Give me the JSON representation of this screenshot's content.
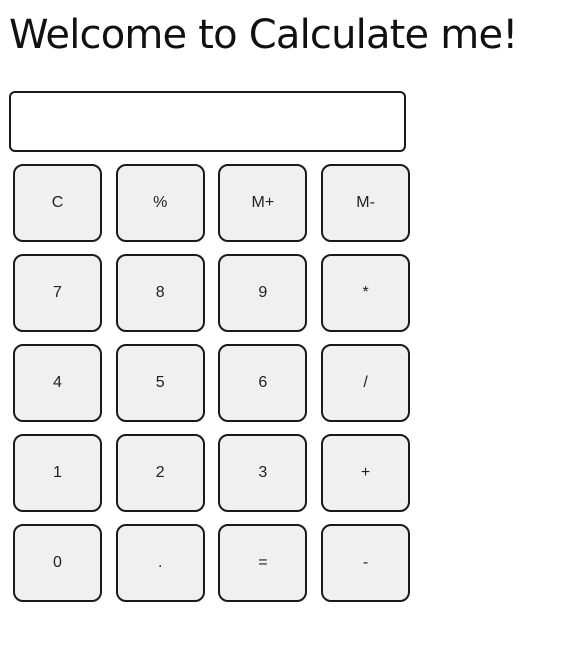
{
  "header": {
    "title": "Welcome to Calculate me!"
  },
  "display": {
    "value": ""
  },
  "keypad": {
    "rows": [
      [
        {
          "label": "C",
          "name": "clear-button"
        },
        {
          "label": "%",
          "name": "percent-button"
        },
        {
          "label": "M+",
          "name": "memory-add-button"
        },
        {
          "label": "M-",
          "name": "memory-subtract-button"
        }
      ],
      [
        {
          "label": "7",
          "name": "digit-7-button"
        },
        {
          "label": "8",
          "name": "digit-8-button"
        },
        {
          "label": "9",
          "name": "digit-9-button"
        },
        {
          "label": "*",
          "name": "multiply-button"
        }
      ],
      [
        {
          "label": "4",
          "name": "digit-4-button"
        },
        {
          "label": "5",
          "name": "digit-5-button"
        },
        {
          "label": "6",
          "name": "digit-6-button"
        },
        {
          "label": "/",
          "name": "divide-button"
        }
      ],
      [
        {
          "label": "1",
          "name": "digit-1-button"
        },
        {
          "label": "2",
          "name": "digit-2-button"
        },
        {
          "label": "3",
          "name": "digit-3-button"
        },
        {
          "label": "+",
          "name": "add-button"
        }
      ],
      [
        {
          "label": "0",
          "name": "digit-0-button"
        },
        {
          "label": ".",
          "name": "decimal-point-button"
        },
        {
          "label": "=",
          "name": "equals-button"
        },
        {
          "label": "-",
          "name": "subtract-button"
        }
      ]
    ]
  }
}
